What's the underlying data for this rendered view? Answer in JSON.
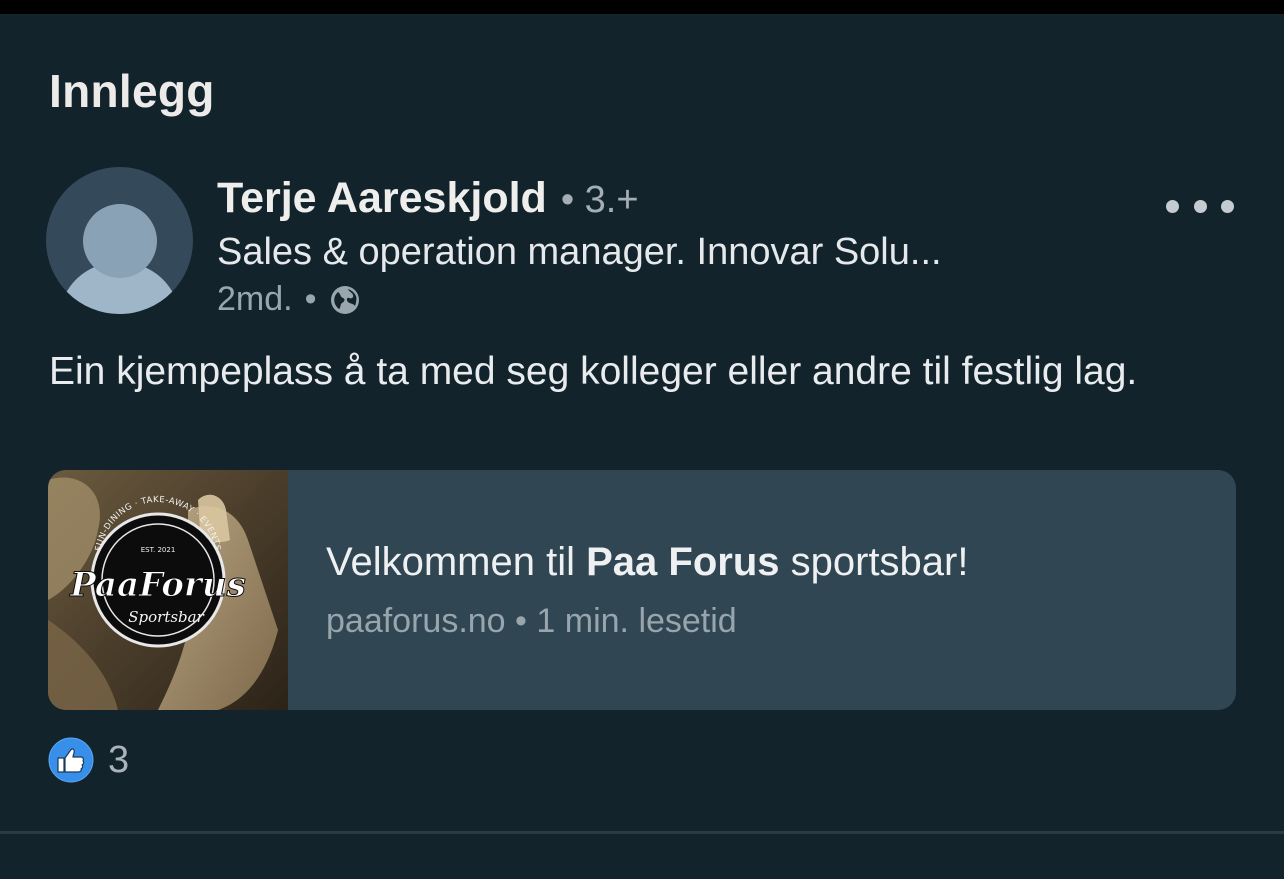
{
  "section": {
    "title": "Innlegg"
  },
  "post": {
    "author": {
      "name": "Terje Aareskjold",
      "degree": "• 3.+",
      "headline": "Sales & operation manager. Innovar Solu..."
    },
    "meta": {
      "age": "2md.",
      "separator": "•",
      "visibility_icon": "globe-icon"
    },
    "menu_icon": "more-horizontal-icon",
    "text": "Ein kjempeplass å ta med seg kolleger eller andre til festlig lag.",
    "link_preview": {
      "title_prefix": "Velkommen til ",
      "title_bold": "Paa Forus",
      "title_suffix": " sportsbar!",
      "domain": "paaforus.no",
      "separator": "•",
      "read_time": "1 min. lesetid",
      "thumbnail": {
        "logo_main": "PaaForus",
        "logo_sub": "Sportsbar",
        "logo_ring_text": "FUN-DINING · TAKE-AWAY · EVENTS",
        "logo_est": "EST. 2021"
      }
    },
    "reactions": {
      "icon": "like-icon",
      "count": "3"
    }
  },
  "colors": {
    "background": "#13232c",
    "card": "#304653",
    "like_blue": "#378fe9"
  }
}
